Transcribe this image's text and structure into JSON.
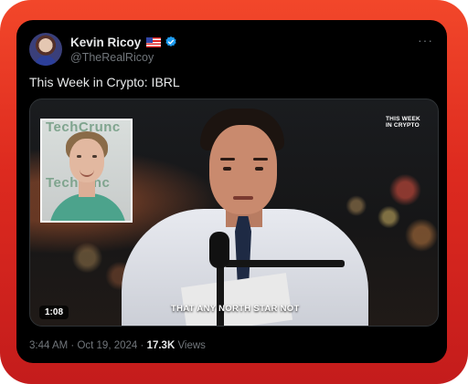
{
  "user": {
    "name": "Kevin Ricoy",
    "handle": "@TheRealRicoy",
    "flag": "us-flag-icon",
    "verified": "verified-badge-icon"
  },
  "more_menu": "···",
  "tweet": {
    "text": "This Week in Crypto: IBRL"
  },
  "video": {
    "inset_sign_top": "TechCrunc",
    "inset_sign_bottom": "Techrunc",
    "brand_line1": "THIS WEEK",
    "brand_line2": "IN CRYPTO",
    "caption": "THAT ANY NORTH STAR NOT",
    "duration": "1:08"
  },
  "meta": {
    "time": "3:44 AM",
    "separator": "·",
    "date": "Oct 19, 2024",
    "views_count": "17.3K",
    "views_label": "Views"
  },
  "colors": {
    "frame_top": "#f2472a",
    "frame_bottom": "#c41c1c",
    "card_bg": "#000000",
    "primary_text": "#e7e9ea",
    "secondary_text": "#71767b",
    "verified_blue": "#1d9bf0"
  }
}
